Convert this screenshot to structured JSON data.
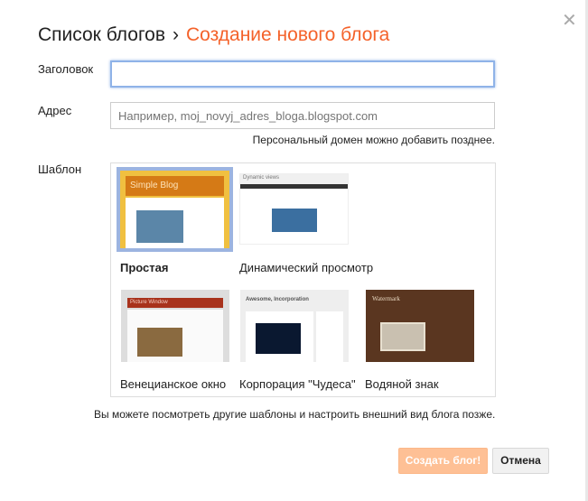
{
  "header": {
    "breadcrumb_parent": "Список блогов",
    "separator": "›",
    "current": "Создание нового блога",
    "close_icon": "close-icon"
  },
  "form": {
    "title_label": "Заголовок",
    "title_value": "",
    "address_label": "Адрес",
    "address_placeholder": "Например, moj_novyj_adres_bloga.blogspot.com",
    "address_hint": "Персональный домен можно добавить позднее.",
    "template_label": "Шаблон"
  },
  "templates": [
    {
      "name": "Простая",
      "thumb_title": "Simple Blog",
      "selected": true
    },
    {
      "name": "Динамический просмотр",
      "thumb_title": "Dynamic views",
      "selected": false
    },
    {
      "name": "Венецианское окно",
      "thumb_title": "Picture Window",
      "selected": false
    },
    {
      "name": "Корпорация \"Чудеса\"",
      "thumb_title": "Awesome, Incorporation",
      "selected": false
    },
    {
      "name": "Водяной знак",
      "thumb_title": "Watermark",
      "selected": false
    }
  ],
  "footer_note": "Вы можете посмотреть другие шаблоны и настроить внешний вид блога позже.",
  "buttons": {
    "create": "Создать блог!",
    "cancel": "Отмена"
  },
  "colors": {
    "accent": "#f4622a",
    "create_button": "#fec095",
    "selected_border": "#9cb4e0"
  }
}
